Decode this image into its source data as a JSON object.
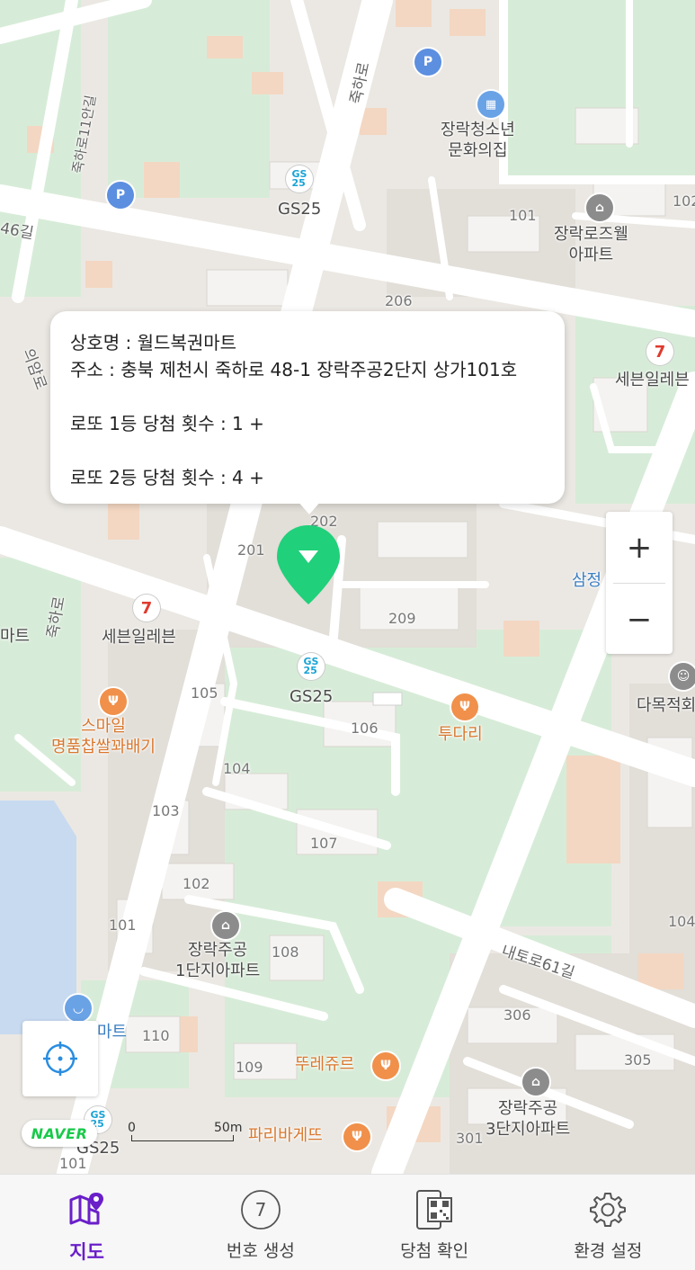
{
  "colors": {
    "accent": "#6a1fc9",
    "marker": "#20d07a",
    "naver": "#19c94a"
  },
  "map": {
    "labels": {
      "jukharo": "죽하로",
      "jukharo_11": "죽하로11안길",
      "road46": "46길",
      "gs_top": "GS25",
      "youth_center": "장락청소년\n문화의집",
      "bldg_101_top": "101",
      "bldg_102_right": "102",
      "rosewell": "장락로즈웰\n아파트",
      "bldg_206": "206",
      "seven_right": "세븐일레븐",
      "uiam": "의암로",
      "bldg_202": "202",
      "bldg_201": "201",
      "bldg_209": "209",
      "samjeong": "삼정",
      "jukharo_left": "죽하로",
      "mart_left": "마트",
      "seven_left": "세븐일레븐",
      "gs_mid": "GS25",
      "bldg_105": "105",
      "bldg_106": "106",
      "tudari": "투다리",
      "damok": "다목적회",
      "smile": "스마일\n명품찹쌀꽈배기",
      "bldg_104": "104",
      "bldg_103": "103",
      "bldg_107": "107",
      "bldg_102": "102",
      "bldg_101": "101",
      "apt1": "장락주공\n1단지아파트",
      "bldg_108": "108",
      "bldg_104_right": "104",
      "naetoro": "내토로61길",
      "bldg_306": "306",
      "bldg_305": "305",
      "mart_bottom": "마트",
      "bldg_110": "110",
      "bldg_109": "109",
      "tous": "뚜레쥬르",
      "apt3": "장락주공\n3단지아파트",
      "paris": "파리바게뜨",
      "bldg_301": "301",
      "gs_bottom": "GS25",
      "bldg_101_bottom": "101"
    },
    "gs_icon_text": "GS\n25",
    "park_icon": "P",
    "seven_icon": "7"
  },
  "popup": {
    "store_line": "상호명 : 월드복권마트",
    "address_line": "주소 : 충북 제천시 죽하로 48-1 장락주공2단지 상가101호",
    "first_prize_line": "로또 1등 당첨 횟수 :  1 +",
    "second_prize_line": "로또 2등 당첨 횟수 :  4 +"
  },
  "zoom": {
    "in": "+",
    "out": "−"
  },
  "naver_logo": "NAVER",
  "scale": {
    "zero": "0",
    "distance": "50m"
  },
  "tabs": [
    {
      "label": "지도",
      "icon": "map-pin-icon",
      "active": true
    },
    {
      "label": "번호 생성",
      "icon": "number-ball-icon",
      "ball_number": "7"
    },
    {
      "label": "당첨 확인",
      "icon": "qr-scan-icon"
    },
    {
      "label": "환경 설정",
      "icon": "gear-icon"
    }
  ]
}
